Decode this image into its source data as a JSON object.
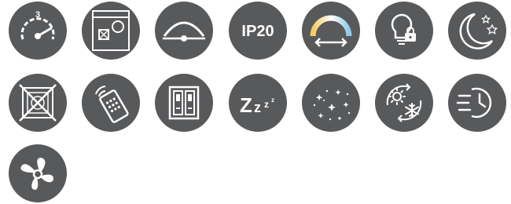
{
  "icons": {
    "speed_level": {
      "label": "3"
    },
    "ip_rating": {
      "prefix": "IP",
      "value": "20"
    },
    "sleep": {
      "big": "Z",
      "mid": "z",
      "small": "z",
      "tiny": "z"
    }
  },
  "colors": {
    "badge_bg": "#58595b",
    "glyph": "#ffffff",
    "cct_warm": "#f6c85f",
    "cct_cool": "#8fc9ea"
  }
}
